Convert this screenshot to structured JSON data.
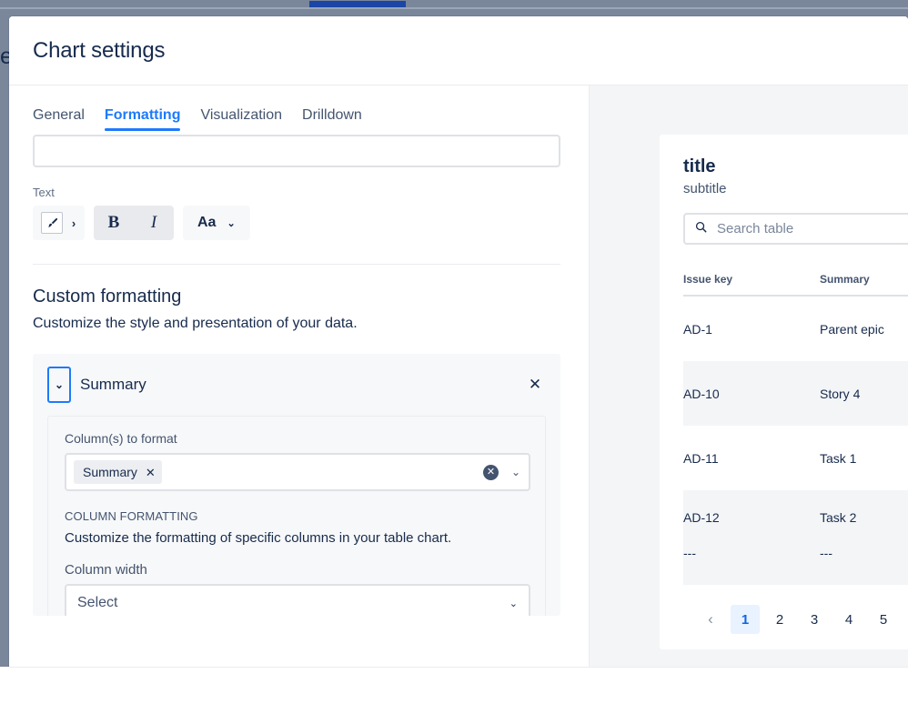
{
  "overlay": {
    "background_color": "#7A869A",
    "accent_tab_color": "#1B45A6",
    "background_letter": "e"
  },
  "modal": {
    "title": "Chart settings",
    "tabs": [
      {
        "label": "General",
        "active": false
      },
      {
        "label": "Formatting",
        "active": true
      },
      {
        "label": "Visualization",
        "active": false
      },
      {
        "label": "Drilldown",
        "active": false
      }
    ],
    "name_input": {
      "value": "",
      "placeholder": ""
    }
  },
  "text_section": {
    "label": "Text",
    "color_picker": {
      "icon": "paintbrush-icon",
      "caret": "›"
    },
    "bold_label": "B",
    "italic_label": "I",
    "font_size_label": "Aa",
    "font_size_caret": "⌄"
  },
  "custom_formatting": {
    "title": "Custom formatting",
    "description": "Customize the style and presentation of your data.",
    "accordion": {
      "chevron": "⌄",
      "title": "Summary",
      "close_label": "✕",
      "columns_label": "Column(s) to format",
      "selected_columns": [
        "Summary"
      ],
      "chip_remove_label": "✕",
      "clear_label": "✕",
      "dropdown_caret": "⌄",
      "column_formatting_label": "COLUMN FORMATTING",
      "column_formatting_desc": "Customize the formatting of specific columns in your table chart.",
      "column_width_label": "Column width",
      "column_width_value": "Select",
      "column_width_caret": "⌄"
    }
  },
  "preview": {
    "title": "title",
    "subtitle": "subtitle",
    "search": {
      "placeholder": "Search table",
      "value": "",
      "icon": "search-icon"
    },
    "table": {
      "columns": [
        "Issue key",
        "Summary"
      ],
      "rows": [
        {
          "issue_key": "AD-1",
          "summary": "Parent epic",
          "sub_key": "",
          "sub_summary": ""
        },
        {
          "issue_key": "AD-10",
          "summary": "Story 4",
          "sub_key": "",
          "sub_summary": ""
        },
        {
          "issue_key": "AD-11",
          "summary": "Task 1",
          "sub_key": "",
          "sub_summary": ""
        },
        {
          "issue_key": "AD-12",
          "summary": "Task 2",
          "sub_key": "---",
          "sub_summary": "---"
        }
      ]
    },
    "pagination": {
      "prev_label": "‹",
      "pages": [
        "1",
        "2",
        "3",
        "4",
        "5"
      ],
      "current": "1",
      "active_bg": "#E9F2FF",
      "active_color": "#0C66E4"
    }
  }
}
